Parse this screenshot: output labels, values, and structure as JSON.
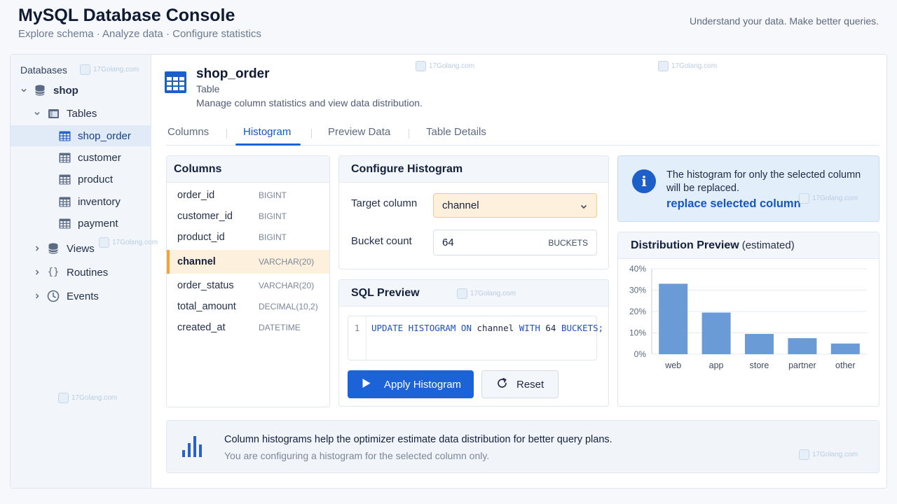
{
  "app": {
    "title": "MySQL Database Console",
    "subtitle": "Explore schema · Analyze data · Configure statistics",
    "tagline": "Understand your data. Make better queries."
  },
  "sidebar": {
    "header": "Databases",
    "database": "shop",
    "tables_label": "Tables",
    "tables": [
      "shop_order",
      "customer",
      "product",
      "inventory",
      "payment"
    ],
    "selected_table": "shop_order",
    "groups": [
      "Views",
      "Routines",
      "Events"
    ]
  },
  "table": {
    "name": "shop_order",
    "type": "Table",
    "description": "Manage column statistics and view data distribution."
  },
  "tabs": [
    "Columns",
    "Histogram",
    "Preview Data",
    "Table Details"
  ],
  "active_tab": "Histogram",
  "columns_panel": {
    "title": "Columns",
    "columns": [
      {
        "name": "order_id",
        "type": "BIGINT"
      },
      {
        "name": "customer_id",
        "type": "BIGINT"
      },
      {
        "name": "product_id",
        "type": "BIGINT"
      },
      {
        "name": "channel",
        "type": "VARCHAR(20)"
      },
      {
        "name": "order_status",
        "type": "VARCHAR(20)"
      },
      {
        "name": "total_amount",
        "type": "DECIMAL(10,2)"
      },
      {
        "name": "created_at",
        "type": "DATETIME"
      }
    ],
    "selected": "channel"
  },
  "configure": {
    "title": "Configure Histogram",
    "target_label": "Target column",
    "target_value": "channel",
    "bucket_label": "Bucket count",
    "bucket_value": "64",
    "bucket_unit": "BUCKETS"
  },
  "sql_preview": {
    "title": "SQL Preview",
    "line_number": "1",
    "kw1": "UPDATE HISTOGRAM ON",
    "column": "channel",
    "kw2": "WITH",
    "count": "64",
    "kw3": "BUCKETS;"
  },
  "buttons": {
    "apply": "Apply Histogram",
    "reset": "Reset"
  },
  "info": {
    "text_1": "The histogram for only the selected column",
    "text_2": "will be replaced.",
    "link": "replace selected column"
  },
  "distribution": {
    "title": "Distribution Preview",
    "note": "(estimated)"
  },
  "chart_data": {
    "type": "bar",
    "categories": [
      "web",
      "app",
      "store",
      "partner",
      "other"
    ],
    "values": [
      33,
      19.5,
      9.5,
      7.5,
      5
    ],
    "yticks": [
      "0%",
      "10%",
      "20%",
      "30%",
      "40%"
    ],
    "ylim": [
      0,
      40
    ],
    "grid": true,
    "color": "#6b9bd6"
  },
  "footer": {
    "main": "Column histograms help the optimizer estimate data distribution for better query plans.",
    "sub": "You are configuring a histogram for the selected column only."
  },
  "watermark": "17Golang.com",
  "colors": {
    "accent": "#1d63d8",
    "selected_column": "#fdf1dd",
    "selected_border": "#f0a53a",
    "info_bg": "#e3eefb"
  }
}
